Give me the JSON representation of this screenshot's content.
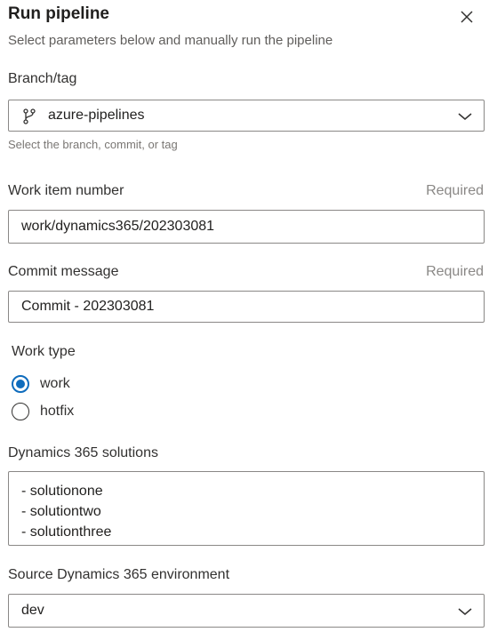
{
  "header": {
    "title": "Run pipeline",
    "subtitle": "Select parameters below and manually run the pipeline"
  },
  "branch": {
    "label": "Branch/tag",
    "value": "azure-pipelines",
    "hint": "Select the branch, commit, or tag",
    "icon": "branch-icon"
  },
  "work_item": {
    "label": "Work item number",
    "required": "Required",
    "value": "work/dynamics365/202303081"
  },
  "commit": {
    "label": "Commit message",
    "required": "Required",
    "value": "Commit - 202303081"
  },
  "work_type": {
    "label": "Work type",
    "options": [
      {
        "label": "work",
        "selected": true
      },
      {
        "label": "hotfix",
        "selected": false
      }
    ]
  },
  "solutions": {
    "label": "Dynamics 365 solutions",
    "lines": [
      "- solutionone",
      "- solutiontwo",
      "- solutionthree"
    ]
  },
  "source_env": {
    "label": "Source Dynamics 365 environment",
    "value": "dev"
  },
  "colors": {
    "accent": "#0f6cbd",
    "border": "#8a8886",
    "muted_text": "#605e5c"
  }
}
